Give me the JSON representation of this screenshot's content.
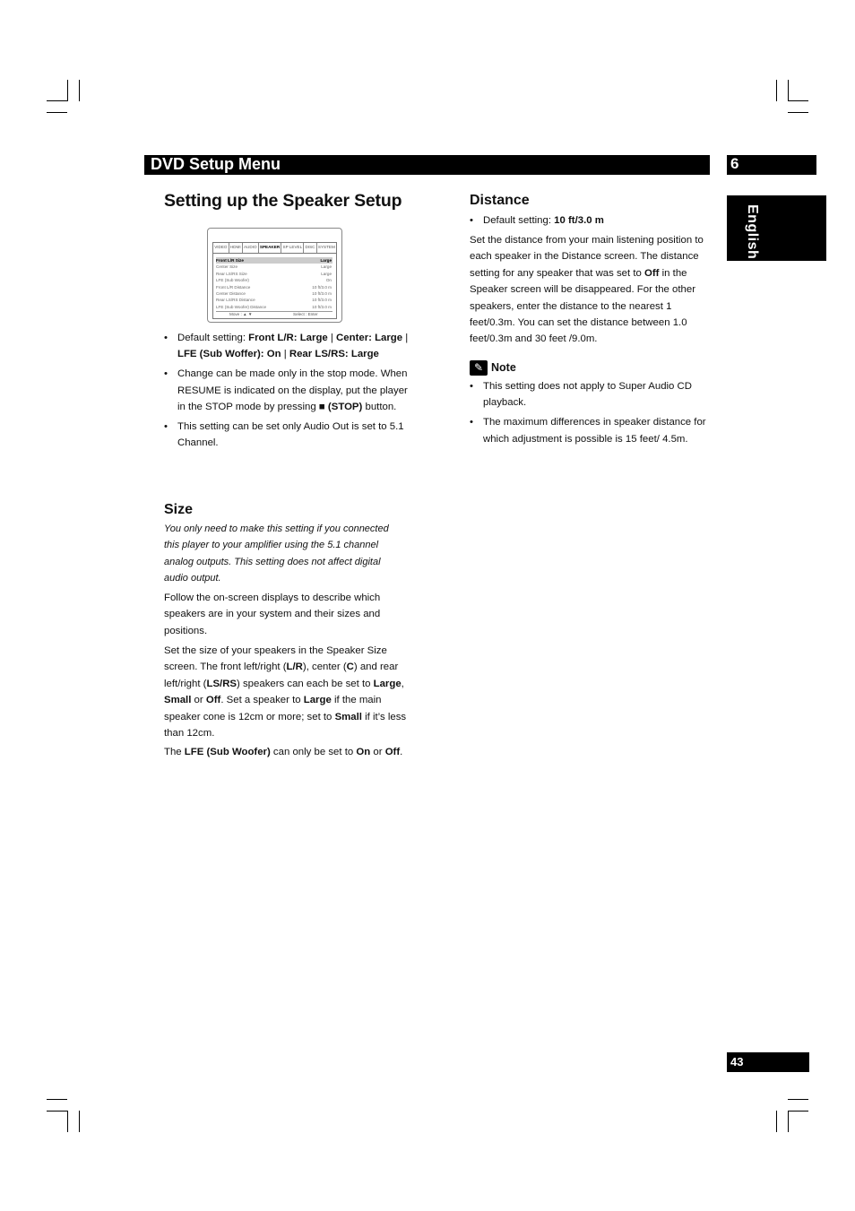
{
  "header": {
    "title": "DVD Setup Menu",
    "chapter_number": "6"
  },
  "language_tab": "English",
  "section_title": "Setting up the Speaker Setup",
  "osd": {
    "tabs": [
      "VIDEO",
      "HDMI",
      "AUDIO",
      "SPEAKER",
      "SP LEVEL",
      "DISC",
      "SYSTEM"
    ],
    "active_tab": "SPEAKER",
    "rows": [
      {
        "label": "Front L/R Size",
        "value": "Large"
      },
      {
        "label": "Center Size",
        "value": "Large"
      },
      {
        "label": "Rear LS/RS Size",
        "value": "Large"
      },
      {
        "label": "LFE (Sub Woofer)",
        "value": "On"
      },
      {
        "label": "Front L/R Distance",
        "value": "10 ft/3.0 m"
      },
      {
        "label": "Center Distance",
        "value": "10 ft/3.0 m"
      },
      {
        "label": "Rear LS/RS Distance",
        "value": "10 ft/3.0 m"
      },
      {
        "label": "LFE (Sub Woofer) Distance",
        "value": "10 ft/3.0 m"
      }
    ],
    "footer_move": "Move : ▲ ▼",
    "footer_select": "Select : Enter"
  },
  "left_bullets": {
    "default_prefix": "Default setting: ",
    "default_front": "Front L/R: Large",
    "default_center": "Center: Large",
    "default_lfe": "LFE (Sub Woffer): On",
    "default_rear": "Rear LS/RS: Large",
    "separator": " | ",
    "stop_mode_text": "Change can be made only in the stop mode. When RESUME is indicated on the display, put the player in the STOP mode by pressing ■ ",
    "stop_button": "(STOP)",
    "stop_suffix": " button.",
    "audio_out_text": "This setting can be set only Audio Out is set to 5.1 Channel."
  },
  "size": {
    "heading": "Size",
    "intro_italic": "You only need to make this setting if you connected this player to your amplifier using the 5.1 channel analog outputs. This setting does not affect digital audio output.",
    "follow_text": "Follow the on-screen displays to describe which speakers are in your system and their sizes and positions.",
    "set_size_parts": {
      "p1": "Set the size of your speakers in the Speaker Size screen. The front left/right (",
      "lr": "L/R",
      "p2": "), center (",
      "c": "C",
      "p3": ") and rear left/right (",
      "lsrs": "LS/RS",
      "p4": ") speakers can each be set to ",
      "large": "Large",
      "p5": ", ",
      "small": "Small",
      "p6": " or ",
      "off": "Off",
      "p7": ". Set a speaker to ",
      "large2": "Large",
      "p8": " if the main speaker cone is 12cm or more; set to ",
      "small2": "Small",
      "p9": " if it’s less than 12cm."
    },
    "lfe_parts": {
      "p1": "The ",
      "lfe": "LFE (Sub Woofer)",
      "p2": " can only be set to ",
      "on": "On",
      "p3": " or ",
      "off": "Off",
      "p4": "."
    }
  },
  "distance": {
    "heading": "Distance",
    "default_prefix": "Default setting: ",
    "default_value": "10 ft/3.0 m",
    "body_p1": "Set the distance from your main listening position to each speaker in the Distance screen. The distance setting for any speaker that was set to ",
    "body_off": "Off",
    "body_p2": " in the Speaker screen will be disappeared. For the other speakers, enter the distance to the nearest 1 feet/0.3m. You can set the distance between 1.0 feet/0.3m and 30 feet /9.0m."
  },
  "note": {
    "icon": "pencil-icon",
    "label": "Note",
    "items": [
      "This setting does not apply to Super Audio CD playback.",
      "The maximum differences in speaker distance for which adjustment is possible is 15 feet/ 4.5m."
    ]
  },
  "page_number": "43"
}
